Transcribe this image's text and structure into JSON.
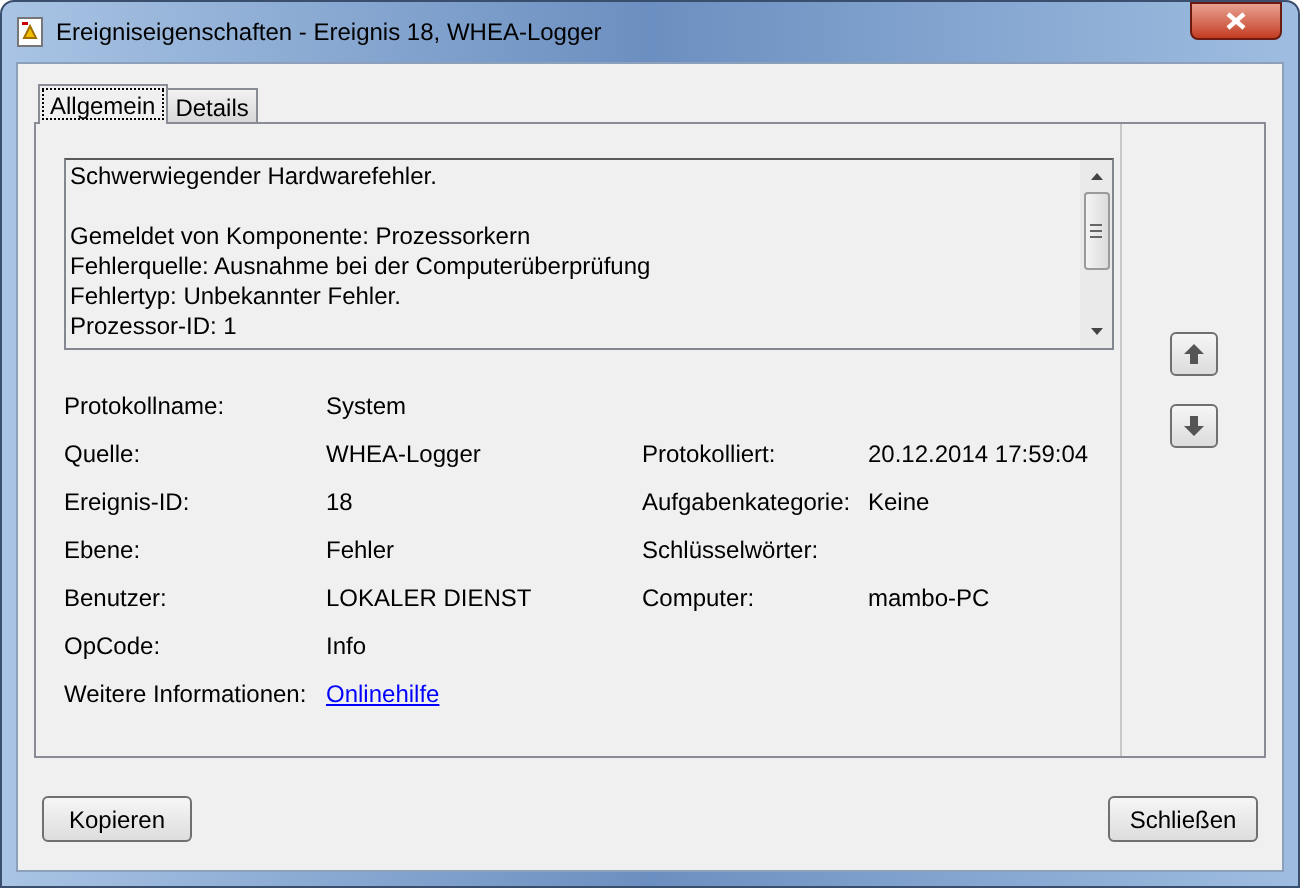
{
  "window": {
    "title": "Ereigniseigenschaften - Ereignis 18, WHEA-Logger"
  },
  "tabs": [
    {
      "label": "Allgemein",
      "selected": true
    },
    {
      "label": "Details",
      "selected": false
    }
  ],
  "description": [
    [
      "Schwerwiegender Hardwarefehler."
    ],
    [
      "Gemeldet von Komponente: Prozessorkern",
      "Fehlerquelle: Ausnahme bei der Computerüberprüfung",
      "Fehlertyp: Unbekannter Fehler.",
      "Prozessor-ID: 1"
    ]
  ],
  "rows": [
    {
      "left": {
        "label": "Protokollname:",
        "value": "System",
        "kind": "text"
      }
    },
    {
      "left": {
        "label": "Quelle:",
        "value": "WHEA-Logger",
        "kind": "text"
      },
      "right": {
        "label": "Protokolliert:",
        "value": "20.12.2014 17:59:04"
      }
    },
    {
      "left": {
        "label": "Ereignis-ID:",
        "value": "18",
        "kind": "text"
      },
      "right": {
        "label": "Aufgabenkategorie:",
        "value": "Keine"
      }
    },
    {
      "left": {
        "label": "Ebene:",
        "value": "Fehler",
        "kind": "text"
      },
      "right": {
        "label": "Schlüsselwörter:"
      }
    },
    {
      "left": {
        "label": "Benutzer:",
        "value": "LOKALER DIENST",
        "kind": "text"
      },
      "right": {
        "label": "Computer:",
        "value": "mambo-PC"
      }
    },
    {
      "left": {
        "label": "OpCode:",
        "value": "Info",
        "kind": "text"
      }
    },
    {
      "left": {
        "label": "Weitere Informationen:",
        "value": "Onlinehilfe",
        "kind": "link"
      }
    }
  ],
  "buttons": [
    "Kopieren",
    "Schließen"
  ]
}
